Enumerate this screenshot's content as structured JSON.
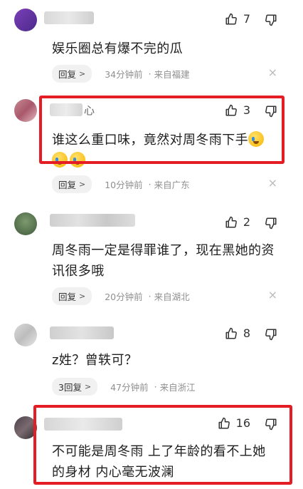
{
  "comments": [
    {
      "text": "娱乐圈总有爆不完的瓜",
      "likes": "7",
      "reply_label": "回复",
      "time": "34分钟前",
      "location": "来自福建"
    },
    {
      "name_fragment": "心",
      "text": "谁这么重口味，竟然对周冬雨下手",
      "likes": "3",
      "reply_label": "回复",
      "time": "10分钟前",
      "location": "来自广东"
    },
    {
      "text": "周冬雨一定是得罪谁了，现在黑她的资讯很多哦",
      "likes": "2",
      "reply_label": "回复",
      "time": "20分钟前",
      "location": "来自湖北"
    },
    {
      "text": "z姓？曾轶可？",
      "likes": "8",
      "reply_label": "3回复",
      "time": "47分钟前",
      "location": "来自浙江"
    },
    {
      "text": "不可能是周冬雨 上了年龄的看不上她的身材 内心毫无波澜",
      "likes": "16"
    }
  ],
  "separator": "·",
  "chevron": ">",
  "close_glyph": "×",
  "colors": {
    "highlight": "#e41d25",
    "meta_text": "#8f8f8f"
  },
  "icons": [
    "thumbs-up-icon",
    "thumbs-down-icon",
    "close-icon",
    "crying-laugh-emoji"
  ]
}
